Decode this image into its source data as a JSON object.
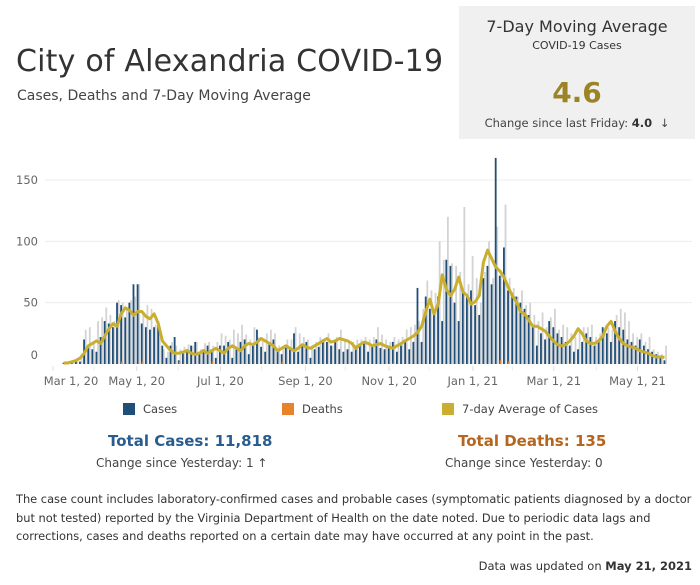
{
  "header": {
    "title": "City of Alexandria COVID-19",
    "subtitle": "Cases, Deaths  and 7-Day Moving Average"
  },
  "kpi": {
    "title": "7-Day Moving Average",
    "subtitle": "COVID-19 Cases",
    "value": "4.6",
    "change_label": "Change since last Friday: ",
    "change_value": "4.0",
    "change_arrow": "↓",
    "value_color": "#9b8426"
  },
  "legend": {
    "cases": "Cases",
    "deaths": "Deaths",
    "avg": "7-day Average of Cases"
  },
  "colors": {
    "cases": "#1f4e79",
    "cases_light": "#d3d3d3",
    "deaths": "#e8832a",
    "avg": "#c9ae2f",
    "total_cases": "#2a5d8f",
    "total_deaths": "#b5651d"
  },
  "totals": {
    "cases_label": "Total Cases: 11,818",
    "cases_change": "Change since Yesterday: 1 ↑",
    "deaths_label": "Total Deaths: 135",
    "deaths_change": "Change since Yesterday: 0"
  },
  "note": "The case count includes laboratory-confirmed cases and probable cases (symptomatic patients diagnosed by a doctor but not tested) reported by the Virginia Department of Health on the date noted. Due to periodic data lags and corrections, cases and deaths reported on a certain date may have occurred at any point in the past.",
  "updated": {
    "label": "Data was updated on ",
    "date": "May 21, 2021"
  },
  "chart_data": {
    "type": "bar",
    "title": "Cases, Deaths and 7-Day Moving Average",
    "xlabel": "",
    "ylabel": "",
    "ylim": [
      0,
      165
    ],
    "y_ticks": [
      0,
      50,
      100,
      150
    ],
    "x_ticks": [
      "Mar 1, 20",
      "May 1, 20",
      "Jul 1, 20",
      "Sep 1, 20",
      "Nov 1, 20",
      "Jan 1, 21",
      "Mar 1, 21",
      "May 1, 21"
    ],
    "x_tick_days": [
      0,
      61,
      122,
      184,
      245,
      306,
      365,
      426
    ],
    "grid": true,
    "legend_position": "bottom",
    "sample_interval_days": 3,
    "start_day": 7,
    "series": [
      {
        "name": "Cases",
        "color": "#1f4e79",
        "values": [
          1,
          0,
          2,
          3,
          2,
          20,
          15,
          12,
          10,
          22,
          35,
          33,
          30,
          50,
          48,
          38,
          50,
          65,
          65,
          33,
          30,
          28,
          30,
          35,
          15,
          5,
          15,
          22,
          3,
          10,
          12,
          15,
          18,
          10,
          12,
          15,
          12,
          5,
          15,
          15,
          18,
          5,
          13,
          18,
          20,
          8,
          15,
          28,
          14,
          10,
          18,
          20,
          12,
          8,
          15,
          12,
          25,
          10,
          15,
          18,
          5,
          12,
          14,
          20,
          18,
          15,
          20,
          12,
          10,
          12,
          10,
          15,
          15,
          18,
          10,
          15,
          20,
          13,
          12,
          15,
          18,
          10,
          15,
          20,
          12,
          18,
          62,
          18,
          55,
          45,
          40,
          55,
          35,
          85,
          80,
          50,
          35,
          60,
          55,
          60,
          48,
          40,
          70,
          80,
          65,
          168,
          72,
          95,
          60,
          58,
          55,
          50,
          45,
          40,
          30,
          15,
          25,
          20,
          35,
          30,
          25,
          22,
          18,
          15,
          10,
          12,
          18,
          25,
          22,
          15,
          20,
          30,
          25,
          18,
          35,
          30,
          28,
          20,
          18,
          15,
          20,
          15,
          12,
          10,
          8,
          5,
          3
        ],
        "light_values": [
          0,
          0,
          3,
          5,
          8,
          28,
          30,
          18,
          35,
          38,
          46,
          40,
          35,
          52,
          50,
          45,
          52,
          55,
          65,
          42,
          48,
          45,
          32,
          30,
          12,
          10,
          18,
          15,
          12,
          14,
          16,
          15,
          18,
          12,
          17,
          18,
          15,
          18,
          25,
          23,
          20,
          28,
          25,
          32,
          24,
          20,
          30,
          22,
          20,
          25,
          28,
          25,
          15,
          12,
          20,
          20,
          30,
          25,
          22,
          20,
          15,
          18,
          22,
          20,
          25,
          15,
          22,
          28,
          20,
          18,
          18,
          20,
          20,
          22,
          20,
          22,
          30,
          24,
          20,
          18,
          22,
          20,
          22,
          28,
          30,
          32,
          35,
          45,
          68,
          60,
          58,
          100,
          85,
          120,
          82,
          80,
          75,
          128,
          65,
          88,
          70,
          50,
          75,
          100,
          70,
          112,
          75,
          130,
          70,
          62,
          55,
          60,
          48,
          50,
          40,
          35,
          42,
          30,
          38,
          45,
          28,
          32,
          30,
          25,
          22,
          28,
          30,
          30,
          32,
          22,
          25,
          25,
          30,
          28,
          40,
          45,
          42,
          35,
          25,
          22,
          25,
          18,
          22,
          12,
          10,
          8,
          15
        ]
      },
      {
        "name": "7-day Average of Cases",
        "color": "#c9ae2f",
        "values": [
          0,
          0,
          1,
          2,
          4,
          8,
          14,
          16,
          18,
          16,
          22,
          28,
          32,
          30,
          40,
          45,
          43,
          39,
          42,
          42,
          38,
          36,
          40,
          32,
          18,
          14,
          10,
          8,
          8,
          9,
          10,
          8,
          7,
          8,
          10,
          8,
          10,
          12,
          10,
          8,
          12,
          14,
          12,
          10,
          14,
          16,
          15,
          17,
          20,
          18,
          16,
          14,
          10,
          12,
          14,
          12,
          10,
          12,
          15,
          13,
          12,
          14,
          16,
          18,
          20,
          17,
          18,
          20,
          19,
          18,
          16,
          12,
          15,
          17,
          16,
          14,
          15,
          16,
          14,
          13,
          12,
          14,
          16,
          18,
          20,
          22,
          25,
          30,
          42,
          52,
          40,
          48,
          72,
          60,
          55,
          60,
          70,
          58,
          55,
          48,
          50,
          55,
          82,
          92,
          85,
          78,
          75,
          70,
          62,
          55,
          50,
          42,
          40,
          35,
          30,
          30,
          28,
          26,
          22,
          18,
          15,
          14,
          15,
          18,
          22,
          28,
          24,
          18,
          16,
          16,
          18,
          22,
          30,
          34,
          26,
          20,
          16,
          14,
          13,
          12,
          10,
          9,
          8,
          6,
          5,
          5,
          4.6
        ]
      },
      {
        "name": "Deaths",
        "color": "#e8832a",
        "values": [
          0,
          0,
          0,
          0,
          0,
          0,
          0,
          0,
          0,
          0,
          0,
          0,
          0,
          0,
          2,
          0,
          0,
          0,
          0,
          2,
          0,
          0,
          0,
          0,
          0,
          0,
          0,
          0,
          2,
          0,
          0,
          0,
          0,
          0,
          0,
          0,
          2,
          0,
          0,
          0,
          0,
          0,
          0,
          0,
          0,
          0,
          0,
          0,
          0,
          0,
          0,
          0,
          0,
          2,
          0,
          0,
          0,
          0,
          0,
          0,
          0,
          0,
          0,
          0,
          0,
          0,
          0,
          0,
          0,
          0,
          0,
          0,
          0,
          0,
          0,
          0,
          0,
          0,
          0,
          0,
          1,
          0,
          0,
          0,
          0,
          0,
          0,
          0,
          0,
          0,
          0,
          0,
          0,
          0,
          0,
          0,
          0,
          0,
          0,
          0,
          0,
          0,
          0,
          0,
          0,
          0,
          3,
          0,
          2,
          0,
          0,
          0,
          0,
          0,
          0,
          0,
          0,
          0,
          0,
          0,
          0,
          0,
          0,
          1,
          0,
          0,
          0,
          0,
          0,
          0,
          0,
          0,
          0,
          0,
          0,
          0,
          0,
          0,
          0,
          0,
          0,
          0,
          0,
          0,
          0,
          0,
          0
        ]
      }
    ]
  }
}
